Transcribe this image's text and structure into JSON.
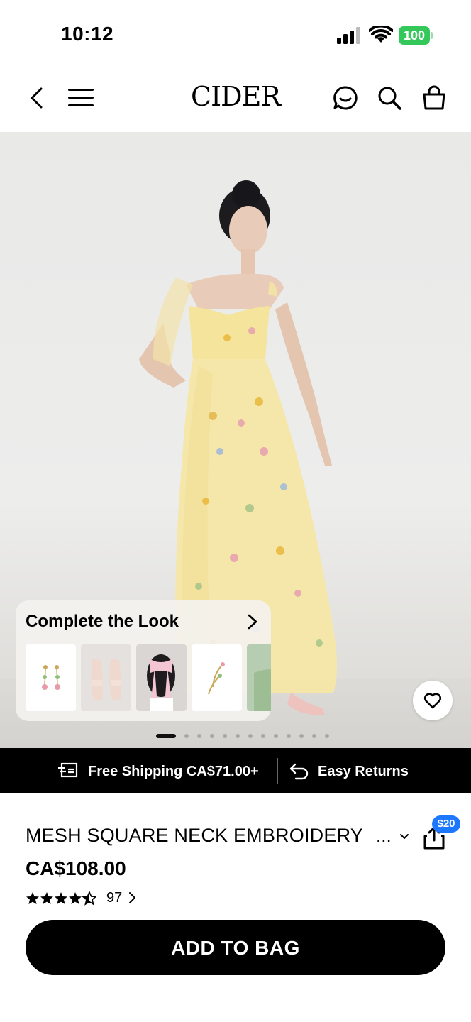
{
  "status_bar": {
    "time": "10:12",
    "battery": "100"
  },
  "header": {
    "logo": "CIDER",
    "icons": [
      "back-icon",
      "menu-icon",
      "chat-icon",
      "search-icon",
      "bag-icon"
    ]
  },
  "hero": {
    "complete_look": {
      "title": "Complete the Look",
      "items": [
        "earrings",
        "mules",
        "hair bow",
        "hair clips",
        "green item"
      ]
    },
    "carousel": {
      "total": 13,
      "active": 1
    }
  },
  "promo": {
    "shipping": "Free Shipping CA$71.00+",
    "returns": "Easy Returns"
  },
  "product": {
    "title": "MESH SQUARE NECK EMBROIDERY",
    "ellipsis": "...",
    "share_badge": "$20",
    "price": "CA$108.00",
    "rating": 4.5,
    "review_count": "97"
  },
  "actions": {
    "add_to_bag": "ADD TO BAG"
  },
  "colors": {
    "accent": "#000000",
    "badge": "#1e78ff",
    "battery": "#34c759"
  }
}
